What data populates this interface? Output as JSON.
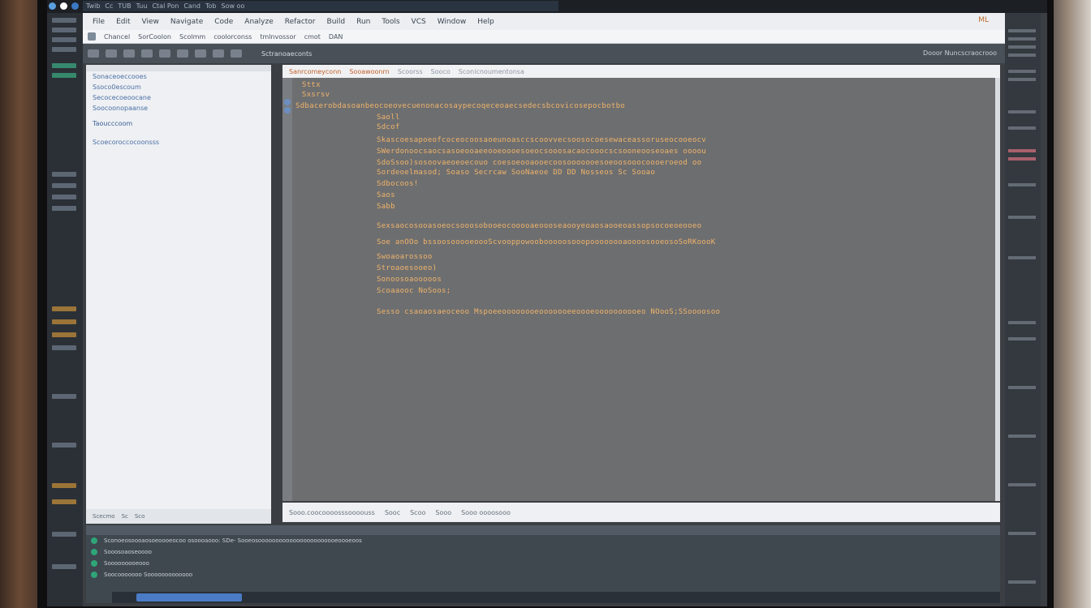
{
  "os_bar": {
    "tabs": [
      "Twib",
      "Cc",
      "TUB",
      "Tuu",
      "Ctal Pon",
      "Cand",
      "Tob",
      "Sow oo"
    ]
  },
  "menubar": {
    "items": [
      "File",
      "Edit",
      "View",
      "Navigate",
      "Code",
      "Analyze",
      "Refactor",
      "Build",
      "Run",
      "Tools",
      "VCS",
      "Window",
      "Help"
    ],
    "badge": "ML",
    "title_segments": [
      "Chancel",
      "SorCoolon",
      "Scolmm",
      "coolorconss",
      "tmlnvossor",
      "cmot",
      "DAN"
    ]
  },
  "toolbar": {
    "path": "Sctranoaeconts",
    "right_text": "Dooor Nuncscraocrooo"
  },
  "explorer": {
    "items": [
      "Sonaceoeccooes",
      "Ssoco0escoum",
      "Secocecoeoocane",
      "Soocoonopaanse",
      "Taoucccoom",
      "Scoecoroccocoonsss"
    ],
    "footer": [
      "Scecmo",
      "Sc",
      "Sco"
    ]
  },
  "editor": {
    "tabs": [
      "Sanrcomeyconn",
      "Sooawoonrn",
      "Scoorss",
      "Sooco",
      "Sconicnoumentonsa"
    ],
    "lines": [
      "Sttx",
      "Sxsrsv",
      "Sdbacerobdasoanbeocoeovecuenonacosaypecoqeceoaecsedecsbcovicosepocbotbo",
      "Saoll",
      "Sdcof",
      "Skascoesapoeofcoceocoosaoeunoasccscoovvecsoosocoesewaceassoruseocooeocv",
      "SWerdonoocsaocsasoeooaeeooeoooesoeocsooosacaocooocscsooneooseoaes oooou",
      "SdoSsoo)sosoovaeoeoecouo coesoeooaooecoosooooooesoeoosooocoooeroeod oo",
      "Sordeoelmasod; Soaso Secrcaw SooNaeoe DD DD Nosseos Sc Sooao",
      "Sdbocoos!",
      "Saos",
      "Sabb",
      "Sexsaocosooasoeocsooosobooeocooooaeoooseaooyeoaosaooeoassopsocoeoeooeo",
      "Soe anOOo bssoosooooeoooScvooppowoobooooosooopoooooooaoooosooeosoSoRKoooK",
      "Swoaoarossoo",
      "Stroaoesooeo)",
      "Sonoosoaooooos",
      "Scoaaooc NoSoos;",
      "Sesso csaoaosaeoceoo Mspoeeoooooooeooooooeeoooeoooooooooeo NOooS;SSoooosoo"
    ],
    "status": [
      "Sooo.coocoooosssoooouss",
      "Sooc",
      "Scoo",
      "Sooo",
      "Sooo oooosooo"
    ]
  },
  "console": {
    "lines": [
      "Sconoeosoooaosoeoooeocoo osoooaooo: SDe- Sooeosooooooooooooooooooooooeoooeoos",
      "Sooosoaoseoooo",
      "Sooooooooeooo",
      "Soocooooooo  Sooooooooooooo"
    ]
  },
  "colors": {
    "editor_bg": "#6d6e70",
    "code_text": "#f0b46a",
    "console_icon": "#2fa578",
    "menu_accent": "#c06a2a"
  }
}
